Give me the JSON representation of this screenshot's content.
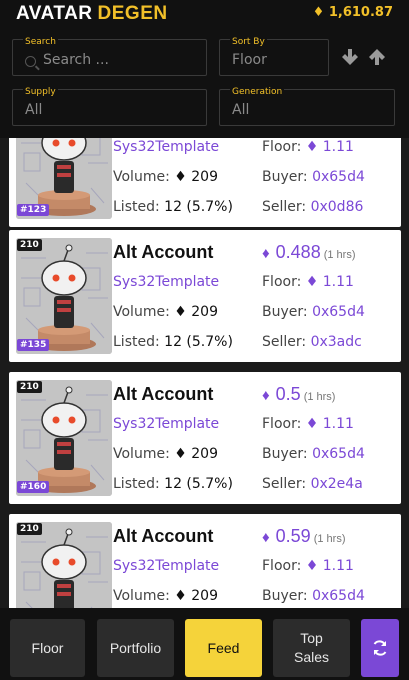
{
  "header": {
    "brand_part1": "AVATAR",
    "brand_part2": "DEGEN",
    "balance": "♦ 1,610.87"
  },
  "filters": {
    "search": {
      "label": "Search",
      "placeholder": "Search ..."
    },
    "sort": {
      "label": "Sort By",
      "value": "Floor"
    },
    "supply": {
      "label": "Supply",
      "value": "All"
    },
    "generation": {
      "label": "Generation",
      "value": "All"
    }
  },
  "listings": [
    {
      "number": "#123",
      "template": "Sys32Template",
      "volume_label": "Volume:",
      "volume": "♦ 209",
      "listed_label": "Listed:",
      "listed": "12 (5.7%)",
      "floor_label": "Floor:",
      "floor": "♦ 1.11",
      "buyer_label": "Buyer:",
      "buyer": "0x65d4",
      "seller_label": "Seller:",
      "seller": "0x0d86"
    },
    {
      "gen": "210",
      "number": "#135",
      "title": "Alt Account",
      "price": "0.488",
      "price_icon": "♦",
      "age": "(1 hrs)",
      "template": "Sys32Template",
      "volume_label": "Volume:",
      "volume": "♦ 209",
      "listed_label": "Listed:",
      "listed": "12 (5.7%)",
      "floor_label": "Floor:",
      "floor": "♦ 1.11",
      "buyer_label": "Buyer:",
      "buyer": "0x65d4",
      "seller_label": "Seller:",
      "seller": "0x3adc"
    },
    {
      "gen": "210",
      "number": "#160",
      "title": "Alt Account",
      "price": "0.5",
      "price_icon": "♦",
      "age": "(1 hrs)",
      "template": "Sys32Template",
      "volume_label": "Volume:",
      "volume": "♦ 209",
      "listed_label": "Listed:",
      "listed": "12 (5.7%)",
      "floor_label": "Floor:",
      "floor": "♦ 1.11",
      "buyer_label": "Buyer:",
      "buyer": "0x65d4",
      "seller_label": "Seller:",
      "seller": "0x2e4a"
    },
    {
      "gen": "210",
      "title": "Alt Account",
      "price": "0.59",
      "price_icon": "♦",
      "age": "(1 hrs)",
      "template": "Sys32Template",
      "volume_label": "Volume:",
      "volume": "♦ 209",
      "floor_label": "Floor:",
      "floor": "♦ 1.11",
      "buyer_label": "Buyer:",
      "buyer": "0x65d4"
    }
  ],
  "nav": {
    "floor": "Floor",
    "portfolio": "Portfolio",
    "feed": "Feed",
    "top_sales_line1": "Top",
    "top_sales_line2": "Sales"
  },
  "colors": {
    "accent_yellow": "#f2c029",
    "accent_purple": "#7b48d6",
    "background": "#111111"
  },
  "icons": {
    "sort_asc": "arrow-down-icon",
    "sort_desc": "arrow-up-icon",
    "refresh": "refresh-icon",
    "search": "search-icon"
  }
}
